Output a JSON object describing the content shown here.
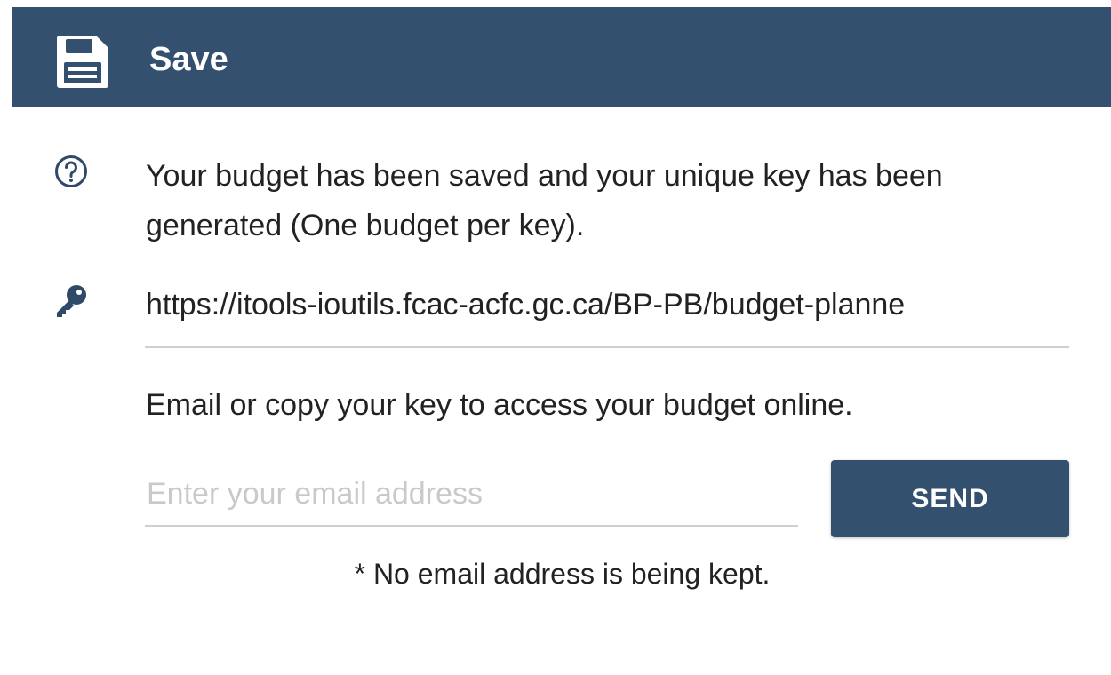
{
  "colors": {
    "header_bg": "#33506f",
    "button_bg": "#33506f",
    "text": "#222222",
    "placeholder": "#c9c9c9",
    "divider": "#cfcfcf"
  },
  "header": {
    "title": "Save",
    "icon": "floppy-disk-icon"
  },
  "info": {
    "icon": "help-circle-icon",
    "text": "Your budget has been saved and your unique key has been generated (One budget per key)."
  },
  "key": {
    "icon": "key-icon",
    "value": "https://itools-ioutils.fcac-acfc.gc.ca/BP-PB/budget-planne"
  },
  "email": {
    "instructions": "Email or copy your key to access your budget online.",
    "placeholder": "Enter your email address",
    "value": "",
    "send_label": "SEND",
    "footnote": "* No email address is being kept."
  }
}
